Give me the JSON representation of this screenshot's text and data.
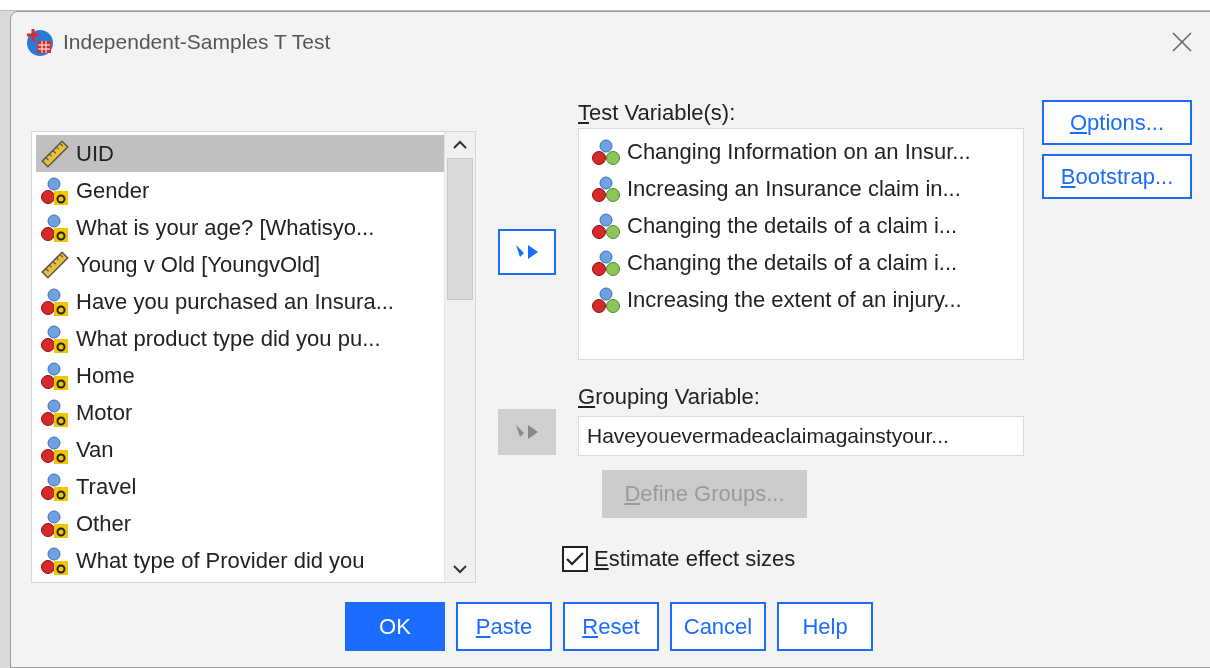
{
  "window": {
    "title": "Independent-Samples T Test"
  },
  "variables": [
    {
      "label": "UID",
      "kind": "scale",
      "selected": true
    },
    {
      "label": "Gender",
      "kind": "string",
      "selected": false
    },
    {
      "label": "What is your age? [Whatisyo...",
      "kind": "string",
      "selected": false
    },
    {
      "label": "Young v Old [YoungvOld]",
      "kind": "scale",
      "selected": false
    },
    {
      "label": "Have you purchased an Insura...",
      "kind": "string",
      "selected": false
    },
    {
      "label": "What product type did you pu...",
      "kind": "string",
      "selected": false
    },
    {
      "label": "Home",
      "kind": "string",
      "selected": false
    },
    {
      "label": "Motor",
      "kind": "string",
      "selected": false
    },
    {
      "label": "Van",
      "kind": "string",
      "selected": false
    },
    {
      "label": "Travel",
      "kind": "string",
      "selected": false
    },
    {
      "label": "Other",
      "kind": "string",
      "selected": false
    },
    {
      "label": "What type of Provider did you",
      "kind": "string",
      "selected": false
    }
  ],
  "move_test_button": {
    "disabled": false
  },
  "test_variables": {
    "label": "Test Variable(s):",
    "underline_first": true,
    "items": [
      {
        "label": "Changing Information on an Insur...",
        "kind": "nominal"
      },
      {
        "label": "Increasing an Insurance claim in...",
        "kind": "nominal"
      },
      {
        "label": "Changing the details of a claim i...",
        "kind": "nominal"
      },
      {
        "label": "Changing the details of a claim i...",
        "kind": "nominal"
      },
      {
        "label": "Increasing the extent of an injury...",
        "kind": "nominal"
      }
    ]
  },
  "move_group_button": {
    "disabled": true
  },
  "grouping": {
    "label": "Grouping Variable:",
    "underline_first": true,
    "value": "Haveyouevermadeaclaimagainstyour..."
  },
  "define_groups": {
    "label": "Define Groups...",
    "underline_first": true,
    "disabled": true
  },
  "side_buttons": [
    {
      "label": "Options...",
      "underline_first": true
    },
    {
      "label": "Bootstrap...",
      "underline_first": true
    }
  ],
  "effect_sizes": {
    "label": "Estimate effect sizes",
    "underline_first": true,
    "checked": true
  },
  "buttons": [
    {
      "label": "OK",
      "kind": "default",
      "underline_first": false
    },
    {
      "label": "Paste",
      "kind": "normal",
      "underline_first": true
    },
    {
      "label": "Reset",
      "kind": "normal",
      "underline_first": true
    },
    {
      "label": "Cancel",
      "kind": "normal",
      "underline_first": false
    },
    {
      "label": "Help",
      "kind": "normal",
      "underline_first": false
    }
  ]
}
